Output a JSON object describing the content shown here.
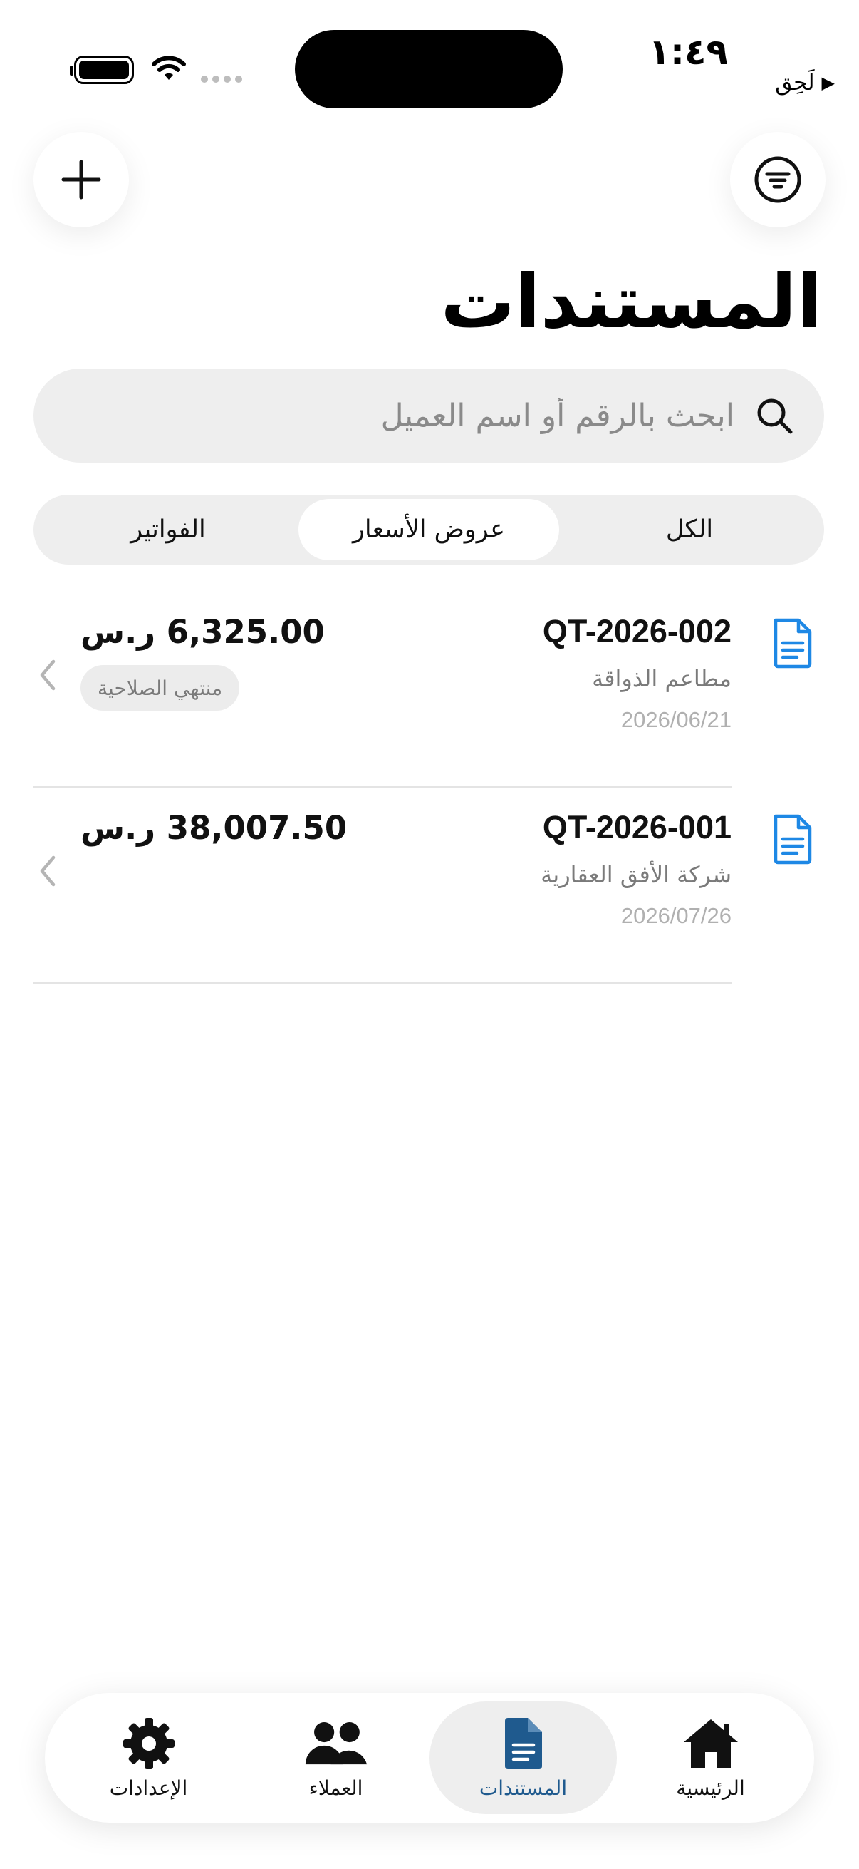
{
  "status_bar": {
    "time": "١:٤٩",
    "back_app": "لَحِق",
    "back_arrow": "▶"
  },
  "header": {
    "add_icon": "plus-icon",
    "filter_icon": "filter-icon",
    "title": "المستندات"
  },
  "search": {
    "placeholder": "ابحث بالرقم أو اسم العميل",
    "value": ""
  },
  "segments": [
    {
      "label": "الكل",
      "active": false
    },
    {
      "label": "عروض الأسعار",
      "active": true
    },
    {
      "label": "الفواتير",
      "active": false
    }
  ],
  "documents": [
    {
      "number": "QT-2026-002",
      "client": "مطاعم الذواقة",
      "date": "2026/06/21",
      "amount": "6,325.00 ر.س",
      "badge": "منتهي الصلاحية"
    },
    {
      "number": "QT-2026-001",
      "client": "شركة الأفق العقارية",
      "date": "2026/07/26",
      "amount": "38,007.50 ر.س",
      "badge": ""
    }
  ],
  "tab_bar": {
    "tabs": [
      {
        "label": "الرئيسية",
        "icon": "home-icon",
        "active": false
      },
      {
        "label": "المستندات",
        "icon": "document-icon",
        "active": true
      },
      {
        "label": "العملاء",
        "icon": "people-icon",
        "active": false
      },
      {
        "label": "الإعدادات",
        "icon": "gear-icon",
        "active": false
      }
    ]
  },
  "colors": {
    "accent": "#1f5a8e",
    "doc_icon": "#1e88e5",
    "background": "#ffffff",
    "surface": "#eeeeee"
  }
}
